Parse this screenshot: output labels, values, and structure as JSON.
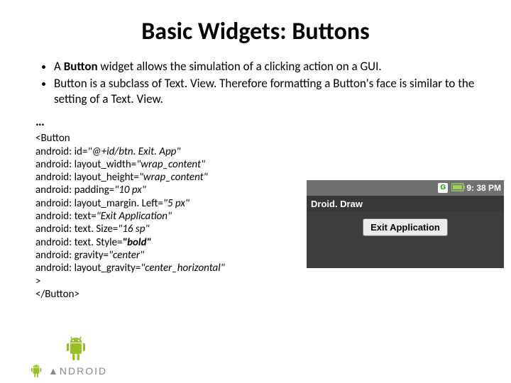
{
  "title": "Basic Widgets: Buttons",
  "bullets": [
    {
      "pre": "A ",
      "bold": "Button",
      "post": " widget allows the simulation of a clicking action on a GUI."
    },
    {
      "pre": "Button is a subclass of Text. View. Therefore formatting a Button's face is similar to the setting of a Text. View.",
      "bold": "",
      "post": ""
    }
  ],
  "ellipsis": "…",
  "code": {
    "open": "<Button",
    "attrs": [
      {
        "k": "android: id=",
        "v": "\"@+id/btn. Exit. App\""
      },
      {
        "k": "android: layout_width=",
        "v": "\"wrap_content\""
      },
      {
        "k": "android: layout_height=",
        "v": "\"wrap_content\""
      },
      {
        "k": "android: padding=",
        "v": "\"10 px\""
      },
      {
        "k": "android: layout_margin. Left=",
        "v": "\"5 px\""
      },
      {
        "k": "android: text=",
        "v": "\"Exit Application\""
      },
      {
        "k": "android: text. Size=",
        "v": "\"16 sp\""
      },
      {
        "k": "android: text. Style=",
        "v": "\"bold\""
      },
      {
        "k": "android: gravity=",
        "v": "\"center\""
      },
      {
        "k": "android: layout_gravity=",
        "v": "\"center_horizontal\""
      }
    ],
    "closeang": ">",
    "close": "</Button>"
  },
  "phone": {
    "time": "9: 38 PM",
    "app_title": "Droid. Draw",
    "button_text": "Exit Application"
  },
  "logo": {
    "text": "▲NDROID"
  }
}
